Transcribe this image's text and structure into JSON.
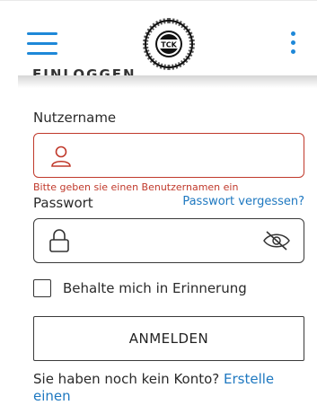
{
  "header": {
    "logo_ring_text": "TENNISCLUB KONOLFINGEN",
    "logo_center_text": "TCK"
  },
  "form": {
    "section_heading": "EINLOGGEN",
    "username_label": "Nutzername",
    "username_value": "",
    "username_error": "Bitte geben sie einen Benutzernamen ein",
    "password_label": "Passwort",
    "password_value": "",
    "forgot_password": "Passwort vergessen?",
    "remember_me": "Behalte mich in Erinnerung",
    "remember_checked": false,
    "login_button": "ANMELDEN",
    "signup_prompt": "Sie haben noch kein Konto?",
    "signup_link": "Erstelle einen"
  },
  "colors": {
    "accent": "#1e88d8",
    "error": "#c0392b",
    "link": "#1e78c0"
  }
}
